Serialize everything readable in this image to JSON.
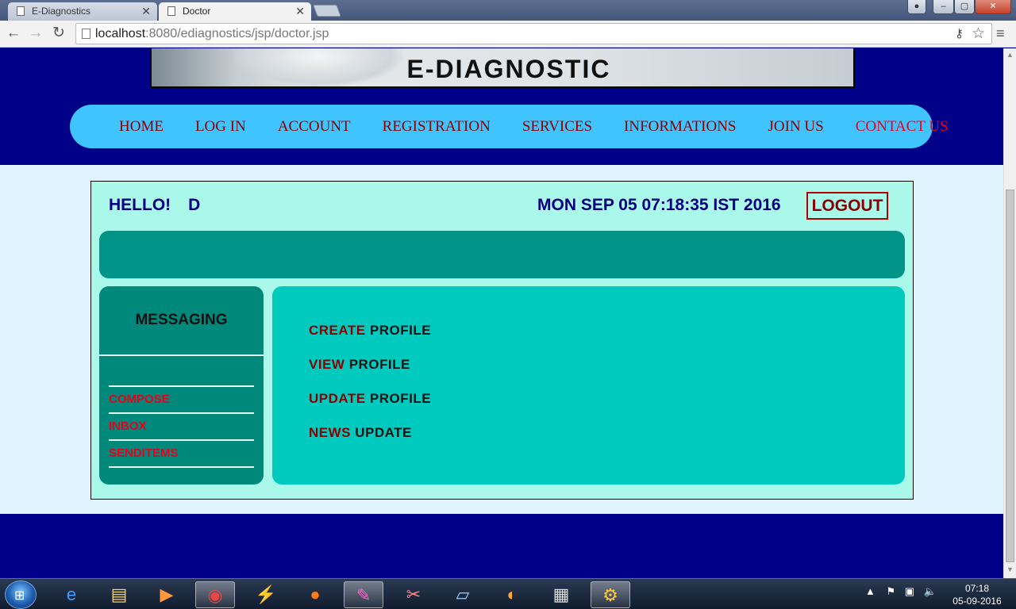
{
  "browser": {
    "tabs": [
      {
        "title": "E-Diagnostics",
        "active": false
      },
      {
        "title": "Doctor",
        "active": true
      }
    ],
    "url_host": "localhost",
    "url_rest": ":8080/ediagnostics/jsp/doctor.jsp",
    "icons": {
      "back": "arrow-left-icon",
      "forward": "arrow-right-icon",
      "reload": "reload-icon",
      "star": "star-icon",
      "menu": "hamburger-menu-icon",
      "key": "key-icon"
    }
  },
  "site": {
    "banner_title": "E-DIAGNOSTIC",
    "nav": [
      "HOME",
      "LOG IN",
      "ACCOUNT",
      "REGISTRATION",
      "SERVICES",
      "INFORMATIONS",
      "JOIN US",
      "CONTACT US"
    ]
  },
  "dashboard": {
    "greeting": "HELLO!",
    "username": "D",
    "datetime": "MON SEP 05 07:18:35 IST 2016",
    "logout": "LOGOUT",
    "messaging": {
      "heading": "MESSAGING",
      "items": [
        "COMPOSE",
        "INBOX",
        "SENDITEMS"
      ]
    },
    "actions": [
      {
        "verb": "CREATE",
        "noun": "PROFILE"
      },
      {
        "verb": "VIEW",
        "noun": "PROFILE"
      },
      {
        "verb": "UPDATE",
        "noun": "PROFILE"
      },
      {
        "verb": "NEWS",
        "noun": "UPDATE"
      }
    ]
  },
  "taskbar": {
    "time": "07:18",
    "date": "05-09-2016"
  },
  "colors": {
    "page_bg": "#000088",
    "nav_bg": "#40c4ff",
    "nav_text": "#8b0000",
    "panel_bg": "#aaf8ea",
    "teal_dark": "#00897b",
    "teal_light": "#00c9bd",
    "link_red": "#e8001c"
  }
}
